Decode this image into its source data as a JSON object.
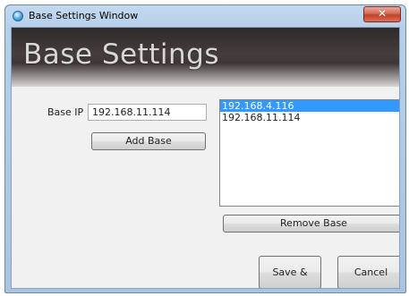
{
  "window": {
    "title": "Base Settings Window",
    "close_glyph": "✕"
  },
  "banner": {
    "title": "Base Settings"
  },
  "form": {
    "base_ip_label": "Base IP :",
    "base_ip_value": "192.168.11.114",
    "add_base_label": "Add Base"
  },
  "base_list": {
    "items": [
      {
        "label": "192.168.4.116",
        "selected": true
      },
      {
        "label": "192.168.11.114",
        "selected": false
      }
    ]
  },
  "actions": {
    "remove_base_label": "Remove Base",
    "save_close_label": "Save & Close",
    "cancel_label": "Cancel"
  },
  "colors": {
    "selection": "#3399ff",
    "banner_dark": "#3e3535",
    "titlebar": "#b6cfe9",
    "close_button": "#c1412a"
  }
}
